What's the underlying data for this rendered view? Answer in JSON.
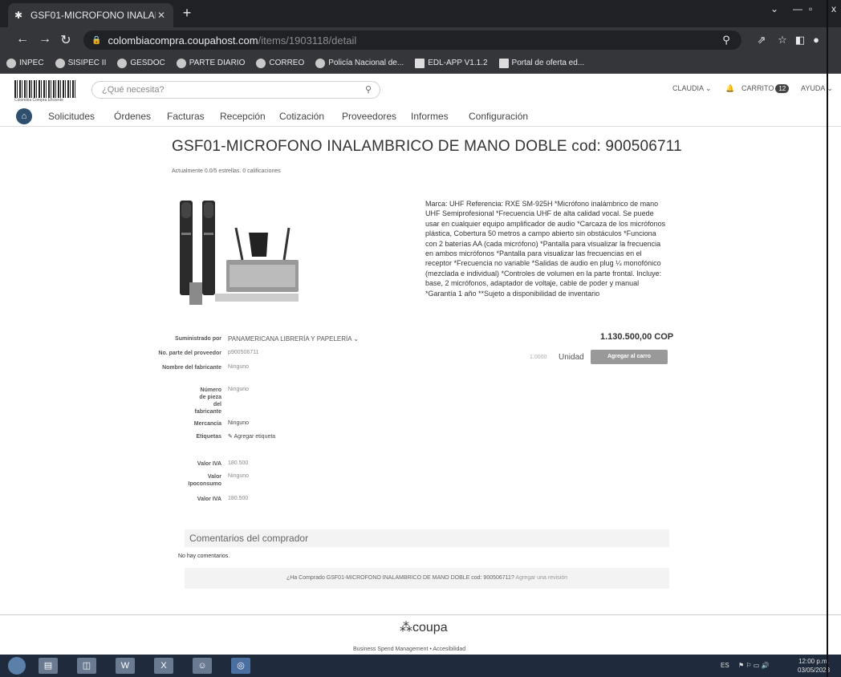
{
  "browser": {
    "tab_title": "GSF01-MICROFONO INALAMBR",
    "url_host": "colombiacompra.coupahost.com",
    "url_path": "/items/1903118/detail",
    "bookmarks": [
      "INPEC",
      "SISIPEC II",
      "GESDOC",
      "PARTE DIARIO",
      "CORREO",
      "Policía Nacional de...",
      "EDL-APP V1.1.2",
      "Portal de oferta ed..."
    ]
  },
  "header": {
    "logo_text": "Colombia Compra Eficiente",
    "search_placeholder": "¿Qué necesita?",
    "user": "CLAUDIA",
    "cart_label": "CARRITO",
    "cart_count": "12",
    "help": "AYUDA"
  },
  "nav": [
    "Solicitudes",
    "Órdenes",
    "Facturas",
    "Recepción",
    "Cotización",
    "Proveedores",
    "Informes",
    "Configuración"
  ],
  "product": {
    "title": "GSF01-MICROFONO INALAMBRICO DE MANO DOBLE cod: 900506711",
    "rating_text": "Actualmente 0.0/5 estrellas. 0 calificaciones",
    "description": "Marca: UHF Referencia: RXE SM-925H *Micrófono inalámbrico de mano UHF Semiprofesional *Frecuencia UHF de alta calidad vocal. Se puede usar en cualquier equipo amplificador de audio *Carcaza de los micrófonos plástica, Cobertura 50 metros a campo abierto sin obstáculos *Funciona con 2 baterías AA (cada micrófono) *Pantalla para visualizar la frecuencia en ambos micrófonos *Pantalla para visualizar las frecuencias en el receptor *Frecuencia no variable *Salidas de audio en plug ¼ monofónico (mezclada e individual) *Controles de volumen en la parte frontal. Incluye: base, 2 micrófonos, adaptador de voltaje, cable de poder y manual *Garantía 1 año **Sujeto a disponibilidad de inventario",
    "price": "1.130.500,00 COP",
    "qty": "1.0000",
    "unit": "Unidad",
    "add_to_cart": "Agregar al carro"
  },
  "fields": {
    "supplied_by_label": "Suministrado por",
    "supplied_by_value": "PANAMERICANA LIBRERÍA Y PAPELERÍA",
    "part_no_label": "No. parte del proveedor",
    "part_no_value": "p900506711",
    "mfr_name_label": "Nombre del fabricante",
    "mfr_name_value": "Ninguno",
    "mfr_part_label": "Número de pieza del fabricante",
    "mfr_part_value": "Ninguno",
    "commodity_label": "Mercancía",
    "commodity_value": "Ninguno",
    "tags_label": "Etiquetas",
    "tags_value": "Agregar etiqueta",
    "iva_label": "Valor IVA",
    "iva_value": "180.500",
    "ipoconsumo_label": "Valor Ipoconsumo",
    "ipoconsumo_value": "Ninguno",
    "iva2_label": "Valor IVA",
    "iva2_value": "180.500"
  },
  "comments": {
    "heading": "Comentarios del comprador",
    "none": "No hay comentarios.",
    "review_prompt": "¿Ha Comprado GSF01-MICROFONO INALAMBRICO DE MANO DOBLE cod: 900506711?",
    "review_link": "Agregar una revisión"
  },
  "footer": {
    "brand": "coupa",
    "text": "Business Spend Management  •  Accesibilidad"
  },
  "taskbar": {
    "lang": "ES",
    "time": "12:00 p.m.",
    "date": "03/05/2023"
  }
}
